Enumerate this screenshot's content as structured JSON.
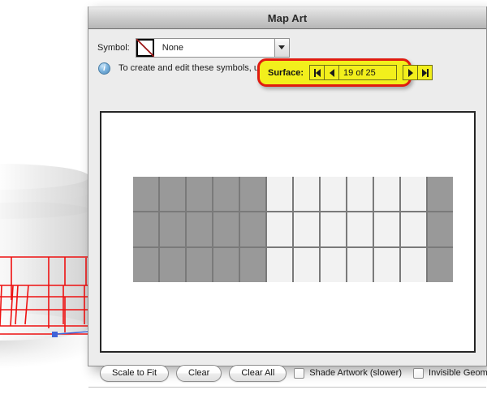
{
  "window": {
    "title": "Map Art"
  },
  "symbol_row": {
    "label": "Symbol:",
    "swatch_icon": "none-slash-icon",
    "value": "None",
    "dropdown_icon": "chevron-down-icon"
  },
  "surface_row": {
    "label": "Surface:",
    "counter": "19 of 25",
    "first_icon": "first-surface-icon",
    "prev_icon": "previous-surface-icon",
    "next_icon": "next-surface-icon",
    "last_icon": "last-surface-icon",
    "highlight_fill": "#f2ef1c",
    "highlight_stroke": "#e01b10"
  },
  "info_row": {
    "icon": "info-icon",
    "glyph": "i",
    "text": "To create and edit these symbols, use the Symbols panel."
  },
  "preview": {
    "artwork": {
      "rows": 3,
      "cols": 12,
      "cell_colors": [
        [
          "gray",
          "gray",
          "gray",
          "gray",
          "gray",
          "white",
          "white",
          "white",
          "white",
          "white",
          "white",
          "gray"
        ],
        [
          "gray",
          "gray",
          "gray",
          "gray",
          "gray",
          "white",
          "white",
          "white",
          "white",
          "white",
          "white",
          "gray"
        ],
        [
          "gray",
          "gray",
          "gray",
          "gray",
          "gray",
          "white",
          "white",
          "white",
          "white",
          "white",
          "white",
          "gray"
        ]
      ],
      "gray_hex": "#999999",
      "white_hex": "#f2f2f2",
      "line_hex": "#7a7a7a"
    }
  },
  "bottom_bar": {
    "buttons": [
      {
        "label": "Scale to Fit"
      },
      {
        "label": "Clear"
      },
      {
        "label": "Clear All"
      }
    ],
    "checkboxes": [
      {
        "label": "Shade Artwork (slower)",
        "checked": false
      },
      {
        "label": "Invisible Geometry",
        "checked": false
      }
    ]
  }
}
